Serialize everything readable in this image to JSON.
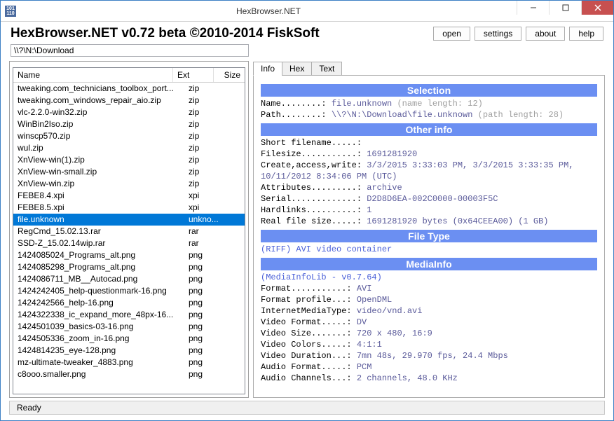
{
  "window": {
    "title": "HexBrowser.NET"
  },
  "header": {
    "app_title": "HexBrowser.NET v0.72 beta  ©2010-2014 FiskSoft",
    "buttons": {
      "open": "open",
      "settings": "settings",
      "about": "about",
      "help": "help"
    }
  },
  "path": "\\\\?\\N:\\Download",
  "columns": {
    "name": "Name",
    "ext": "Ext",
    "size": "Size"
  },
  "files": [
    {
      "name": "tweaking.com_technicians_toolbox_port...",
      "ext": "zip",
      "selected": false
    },
    {
      "name": "tweaking.com_windows_repair_aio.zip",
      "ext": "zip",
      "selected": false
    },
    {
      "name": "vlc-2.2.0-win32.zip",
      "ext": "zip",
      "selected": false
    },
    {
      "name": "WinBin2Iso.zip",
      "ext": "zip",
      "selected": false
    },
    {
      "name": "winscp570.zip",
      "ext": "zip",
      "selected": false
    },
    {
      "name": "wul.zip",
      "ext": "zip",
      "selected": false
    },
    {
      "name": "XnView-win(1).zip",
      "ext": "zip",
      "selected": false
    },
    {
      "name": "XnView-win-small.zip",
      "ext": "zip",
      "selected": false
    },
    {
      "name": "XnView-win.zip",
      "ext": "zip",
      "selected": false
    },
    {
      "name": "FEBE8.4.xpi",
      "ext": "xpi",
      "selected": false
    },
    {
      "name": "FEBE8.5.xpi",
      "ext": "xpi",
      "selected": false
    },
    {
      "name": "file.unknown",
      "ext": "unkno...",
      "selected": true
    },
    {
      "name": "RegCmd_15.02.13.rar",
      "ext": "rar",
      "selected": false
    },
    {
      "name": "SSD-Z_15.02.14wip.rar",
      "ext": "rar",
      "selected": false
    },
    {
      "name": "1424085024_Programs_alt.png",
      "ext": "png",
      "selected": false
    },
    {
      "name": "1424085298_Programs_alt.png",
      "ext": "png",
      "selected": false
    },
    {
      "name": "1424086711_MB__Autocad.png",
      "ext": "png",
      "selected": false
    },
    {
      "name": "1424242405_help-questionmark-16.png",
      "ext": "png",
      "selected": false
    },
    {
      "name": "1424242566_help-16.png",
      "ext": "png",
      "selected": false
    },
    {
      "name": "1424322338_ic_expand_more_48px-16...",
      "ext": "png",
      "selected": false
    },
    {
      "name": "1424501039_basics-03-16.png",
      "ext": "png",
      "selected": false
    },
    {
      "name": "1424505336_zoom_in-16.png",
      "ext": "png",
      "selected": false
    },
    {
      "name": "1424814235_eye-128.png",
      "ext": "png",
      "selected": false
    },
    {
      "name": "mz-ultimate-tweaker_4883.png",
      "ext": "png",
      "selected": false
    },
    {
      "name": "c8ooo.smaller.png",
      "ext": "png",
      "selected": false
    }
  ],
  "tabs": {
    "info": "Info",
    "hex": "Hex",
    "text": "Text",
    "active": "info"
  },
  "info": {
    "selection": {
      "heading": "Selection",
      "name_label": "Name........:",
      "name_value": "file.unknown",
      "name_note": "(name length: 12)",
      "path_label": "Path........:",
      "path_value": "\\\\?\\N:\\Download\\file.unknown",
      "path_note": "(path length: 28)"
    },
    "other": {
      "heading": "Other info",
      "short_filename_label": "Short filename.....:",
      "short_filename_value": "",
      "filesize_label": "Filesize...........:",
      "filesize_value": "1691281920",
      "caw_label": "Create,access,write:",
      "caw_value": "3/3/2015 3:33:03 PM, 3/3/2015 3:33:35 PM, 10/11/2012 8:34:06 PM (UTC)",
      "attributes_label": "Attributes.........:",
      "attributes_value": "archive",
      "serial_label": "Serial.............:",
      "serial_value": "D2D8D6EA-002C0000-00003F5C",
      "hardlinks_label": "Hardlinks..........:",
      "hardlinks_value": "1",
      "realsize_label": "Real file size.....:",
      "realsize_value": "1691281920 bytes (0x64CEEA00) (1 GB)"
    },
    "filetype": {
      "heading": "File Type",
      "line1": "(RIFF) AVI video container"
    },
    "mediainfo": {
      "heading": "MediaInfo",
      "lib_line": "(MediaInfoLib - v0.7.64)",
      "format_label": "Format...........:",
      "format_value": "AVI",
      "profile_label": "Format profile...:",
      "profile_value": "OpenDML",
      "imt_label": "InternetMediaType:",
      "imt_value": "video/vnd.avi",
      "vformat_label": "Video Format.....:",
      "vformat_value": "DV",
      "vsize_label": "Video Size.......:",
      "vsize_value": "720 x 480, 16:9",
      "vcolors_label": "Video Colors.....:",
      "vcolors_value": "4:1:1",
      "vduration_label": "Video Duration...:",
      "vduration_value": "7mn 48s, 29.970 fps, 24.4 Mbps",
      "aformat_label": "Audio Format.....:",
      "aformat_value": "PCM",
      "achannels_label": "Audio Channels...:",
      "achannels_value": "2 channels, 48.0 KHz"
    }
  },
  "status": "Ready"
}
